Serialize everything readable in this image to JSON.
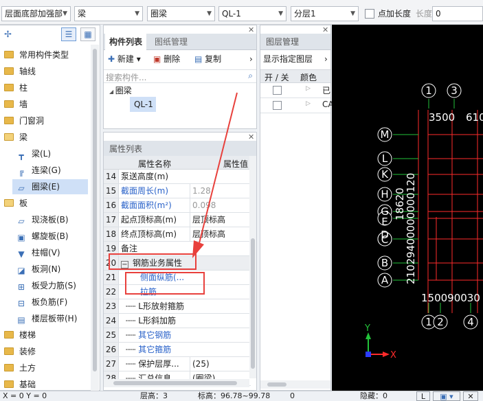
{
  "toolbar": {
    "floor_combo": "层面底部加强部",
    "type_combo": "梁",
    "subtype_combo": "圈梁",
    "component_combo": "QL-1",
    "layer_combo": "分层1",
    "extra_length_label": "点加长度",
    "length_label": "长度:",
    "length_value": "0"
  },
  "sidebar": {
    "items": [
      {
        "label": "常用构件类型"
      },
      {
        "label": "轴线"
      },
      {
        "label": "柱"
      },
      {
        "label": "墙"
      },
      {
        "label": "门窗洞"
      },
      {
        "label": "梁"
      },
      {
        "label": "梁(L)"
      },
      {
        "label": "连梁(G)"
      },
      {
        "label": "圈梁(E)"
      },
      {
        "label": "板"
      },
      {
        "label": "现浇板(B)"
      },
      {
        "label": "螺旋板(B)"
      },
      {
        "label": "柱帽(V)"
      },
      {
        "label": "板洞(N)"
      },
      {
        "label": "板受力筋(S)"
      },
      {
        "label": "板负筋(F)"
      },
      {
        "label": "楼层板带(H)"
      },
      {
        "label": "楼梯"
      },
      {
        "label": "装修"
      },
      {
        "label": "土方"
      },
      {
        "label": "基础"
      }
    ]
  },
  "component_panel": {
    "tabs": [
      "构件列表",
      "图纸管理"
    ],
    "new_label": "新建",
    "delete_label": "删除",
    "copy_label": "复制",
    "search_placeholder": "搜索构件...",
    "tree_root": "圈梁",
    "tree_child": "QL-1"
  },
  "property_panel": {
    "title": "属性列表",
    "col_name": "属性名称",
    "col_value": "属性值",
    "rows": [
      {
        "no": "14",
        "name": "泵送高度(m)",
        "value": ""
      },
      {
        "no": "15",
        "name": "截面周长(m)",
        "value": "1.28"
      },
      {
        "no": "16",
        "name": "截面面积(m²)",
        "value": "0.098"
      },
      {
        "no": "17",
        "name": "起点顶标高(m)",
        "value": "层顶标高"
      },
      {
        "no": "18",
        "name": "终点顶标高(m)",
        "value": "层顶标高"
      },
      {
        "no": "19",
        "name": "备注",
        "value": ""
      },
      {
        "no": "20",
        "name": "钢筋业务属性",
        "value": ""
      },
      {
        "no": "21",
        "name": "侧面纵筋(...",
        "value": ""
      },
      {
        "no": "22",
        "name": "拉筋",
        "value": ""
      },
      {
        "no": "23",
        "name": "L形放射箍筋",
        "value": ""
      },
      {
        "no": "24",
        "name": "L形斜加筋",
        "value": ""
      },
      {
        "no": "25",
        "name": "其它钢筋",
        "value": ""
      },
      {
        "no": "26",
        "name": "其它箍筋",
        "value": ""
      },
      {
        "no": "27",
        "name": "保护层厚...",
        "value": "(25)"
      },
      {
        "no": "28",
        "name": "汇总信息",
        "value": "(圈梁)"
      }
    ]
  },
  "layer_panel": {
    "title": "图层管理",
    "show_label": "显示指定图层",
    "col_on": "开 / 关",
    "col_color": "颜色",
    "rows": [
      {
        "name": "已"
      },
      {
        "name": "CA"
      }
    ]
  },
  "canvas": {
    "top_axes": [
      "1",
      "3"
    ],
    "top_dims": [
      "3500",
      "610"
    ],
    "left_axes": [
      "M",
      "L",
      "K",
      "H",
      "G",
      "E",
      "D",
      "C",
      "B",
      "A"
    ],
    "left_dims": "21029400000000120",
    "left_dim_total": "18620",
    "bottom_dims": "150090030",
    "bottom_axes": [
      "1",
      "2",
      "4"
    ],
    "ucs_x": "X",
    "ucs_y": "Y"
  },
  "status": {
    "coords": "X = 0 Y = 0",
    "floor_height": "层高：3",
    "elevation": "标高：96.78~99.78",
    "zero": "0",
    "hidden": "隐藏：0"
  },
  "colors": {
    "accent": "#2a62c9",
    "annotation_red": "#e8403c",
    "grid_red": "#ff2b2b",
    "canvas_bg": "#000000"
  }
}
